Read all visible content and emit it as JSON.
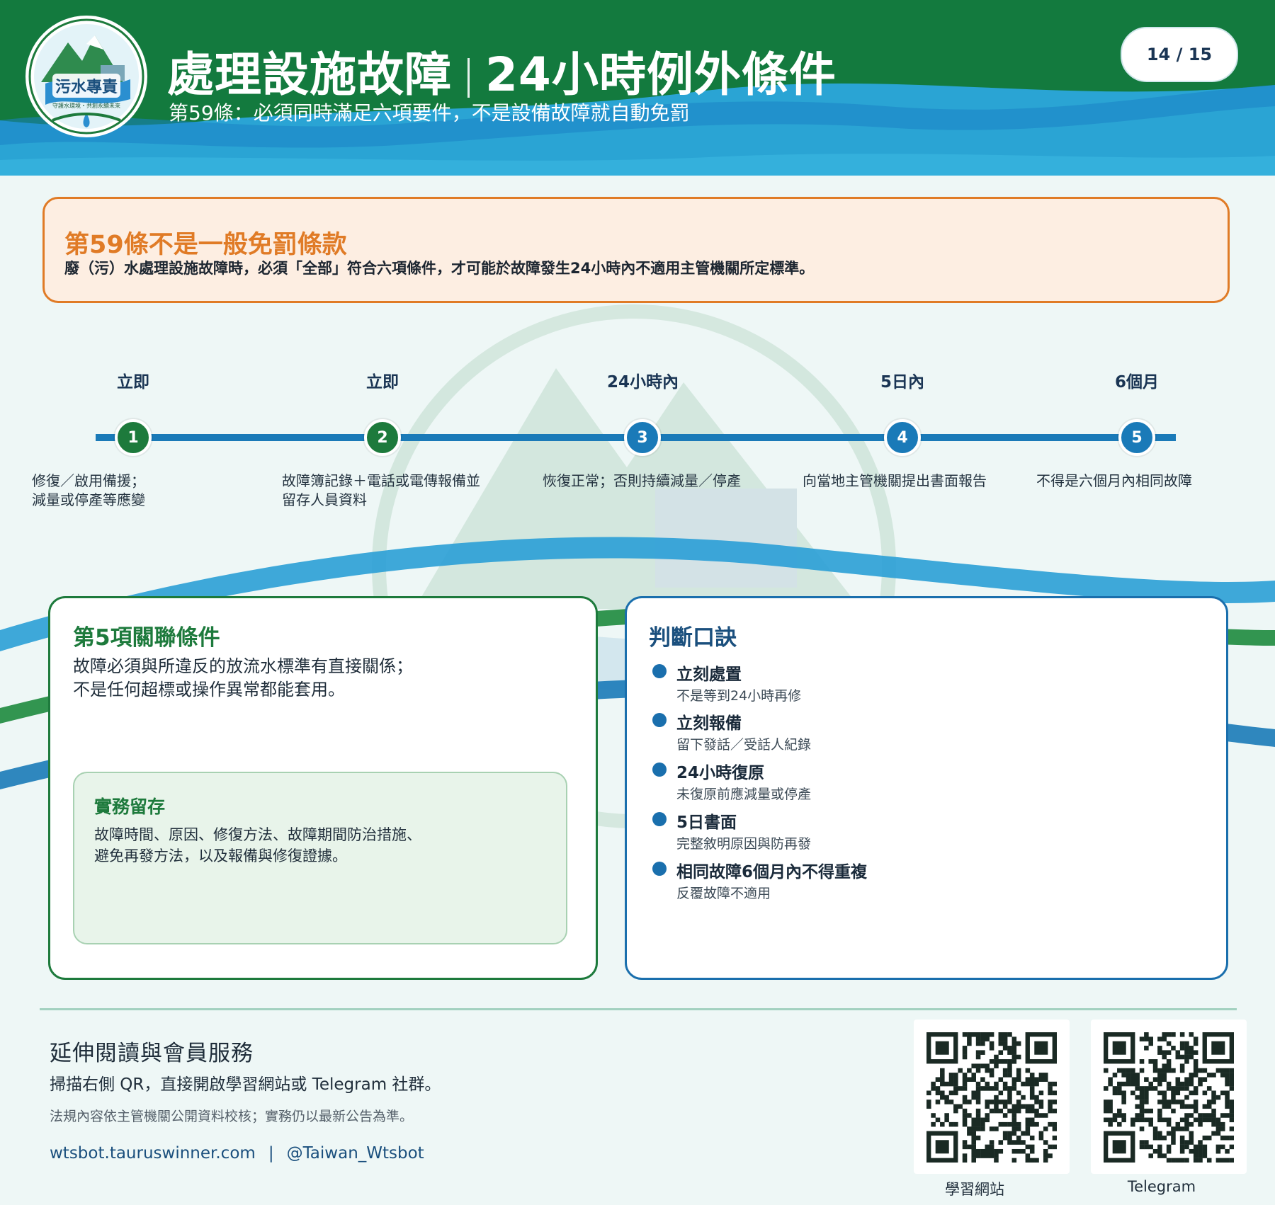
{
  "header": {
    "logo_text": "污水專責",
    "logo_tagline": "守護水環境・共創永續未來",
    "title_left": "處理設施故障",
    "title_right": "24小時例外條件",
    "subtitle": "第59條：必須同時滿足六項要件，不是設備故障就自動免罰",
    "page_indicator": "14 / 15"
  },
  "notice": {
    "title": "第59條不是一般免罰條款",
    "body": "廢（污）水處理設施故障時，必須「全部」符合六項條件，才可能於故障發生24小時內不適用主管機關所定標準。"
  },
  "timeline": {
    "steps": [
      {
        "time": "立即",
        "number": "1",
        "desc_line1": "修復／啟用備援；",
        "desc_line2": "減量或停產等應變",
        "color": "#1d7a3c"
      },
      {
        "time": "立即",
        "number": "2",
        "desc_line1": "故障簿記錄＋電話或電傳報備並",
        "desc_line2": "留存人員資料",
        "color": "#1d7a3c"
      },
      {
        "time": "24小時內",
        "number": "3",
        "desc_line1": "恢復正常；否則持續減量／停產",
        "desc_line2": "",
        "color": "#1a7ab8"
      },
      {
        "time": "5日內",
        "number": "4",
        "desc_line1": "向當地主管機關提出書面報告",
        "desc_line2": "",
        "color": "#1a7ab8"
      },
      {
        "time": "6個月",
        "number": "5",
        "desc_line1": "不得是六個月內相同故障",
        "desc_line2": "",
        "color": "#1a7ab8"
      }
    ]
  },
  "condition5": {
    "title": "第5項關聯條件",
    "body_line1": "故障必須與所違反的放流水標準有直接關係；",
    "body_line2": "不是任何超標或操作異常都能套用。",
    "practice": {
      "title": "實務留存",
      "body_line1": "故障時間、原因、修復方法、故障期間防治措施、",
      "body_line2": "避免再發方法，以及報備與修復證據。"
    }
  },
  "mnemonic": {
    "title": "判斷口訣",
    "items": [
      {
        "title": "立刻處置",
        "sub": "不是等到24小時再修"
      },
      {
        "title": "立刻報備",
        "sub": "留下發話／受話人紀錄"
      },
      {
        "title": "24小時復原",
        "sub": "未復原前應減量或停產"
      },
      {
        "title": "5日書面",
        "sub": "完整敘明原因與防再發"
      },
      {
        "title": "相同故障6個月內不得重複",
        "sub": "反覆故障不適用"
      }
    ]
  },
  "footer": {
    "title": "延伸閱讀與會員服務",
    "scan_text": "掃描右側 QR，直接開啟學習網站或 Telegram 社群。",
    "note": "法規內容依主管機關公開資料校核；實務仍以最新公告為準。",
    "link_site": "wtsbot.tauruswinner.com",
    "separator": "|",
    "link_telegram": "@Taiwan_Wtsbot",
    "qr_site_label": "學習網站",
    "qr_telegram_label": "Telegram"
  },
  "colors": {
    "brand_green": "#1d7a3c",
    "brand_blue": "#1a7ab8",
    "notice_orange": "#e07b26",
    "notice_bg": "#fdeee2"
  }
}
